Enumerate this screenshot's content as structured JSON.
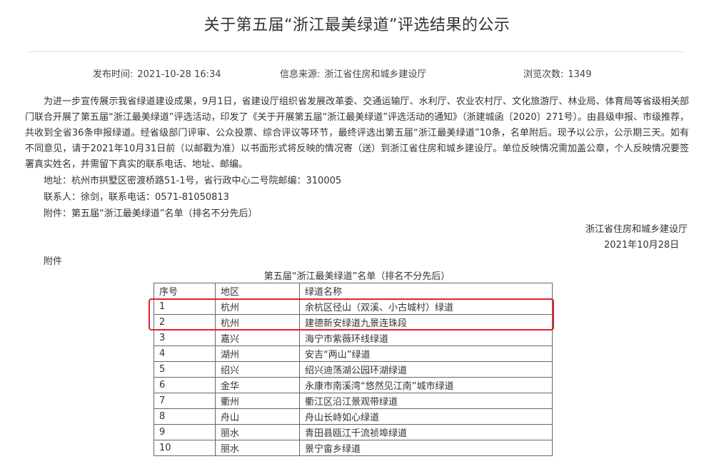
{
  "article": {
    "title": "关于第五届“浙江最美绿道”评选结果的公示",
    "publish_label": "发布时间:",
    "publish_time": "2021-10-28 16:34",
    "source_label": "信息来源:",
    "source": "浙江省住房和城乡建设厅",
    "views_label": "浏览次数:",
    "views": "1349",
    "body": "为进一步宣传展示我省绿道建设成果，9月1日，省建设厅组织省发展改革委、交通运输厅、水利厅、农业农村厅、文化旅游厅、林业局、体育局等省级相关部门联合开展了第五届“浙江最美绿道”评选活动，印发了《关于开展第五届“浙江最美绿道”评选活动的通知》（浙建城函〔2020〕271号）。由县级申报、市级推荐，共收到全省36条申报绿道。经省级部门评审、公众投票、综合评议等环节，最终评选出第五届“浙江最美绿道”10条，名单附后。现予以公示，公示期三天。如有不同意见，请于2021年10月31日前（以邮戳为准）以书面形式将反映的情况寄（送）到浙江省住房和城乡建设厅。单位反映情况需加盖公章，个人反映情况要签署真实姓名，并需留下真实的联系电话、地址、邮编。",
    "address": "地址：杭州市拱墅区密渡桥路51-1号，省行政中心二号院邮编：310005",
    "contact": "联系人：徐剑，联系电话：0571-81050813",
    "attachment_note": "附件：第五届“浙江最美绿道”名单（排名不分先后）",
    "signature_org": "浙江省住房和城乡建设厅",
    "signature_date": "2021年10月28日",
    "attachment_heading": "附件"
  },
  "table": {
    "caption": "第五届“浙江最美绿道”名单（排名不分先后）",
    "headers": [
      "序号",
      "地区",
      "绿道名称"
    ],
    "rows": [
      [
        "1",
        "杭州",
        "余杭区径山（双溪、小古城村）绿道"
      ],
      [
        "2",
        "杭州",
        "建德新安绿道九景连珠段"
      ],
      [
        "3",
        "嘉兴",
        "海宁市紫薇环线绿道"
      ],
      [
        "4",
        "湖州",
        "安吉“两山”绿道"
      ],
      [
        "5",
        "绍兴",
        "绍兴迪荡湖公园环湖绿道"
      ],
      [
        "6",
        "金华",
        "永康市南溪湾“悠然见江南”城市绿道"
      ],
      [
        "7",
        "衢州",
        "衢江区沿江景观带绿道"
      ],
      [
        "8",
        "舟山",
        "舟山长峙如心绿道"
      ],
      [
        "9",
        "丽水",
        "青田县瓯江千流祯埠绿道"
      ],
      [
        "10",
        "丽水",
        "景宁畲乡绿道"
      ]
    ],
    "highlight_color": "#e0242c"
  }
}
